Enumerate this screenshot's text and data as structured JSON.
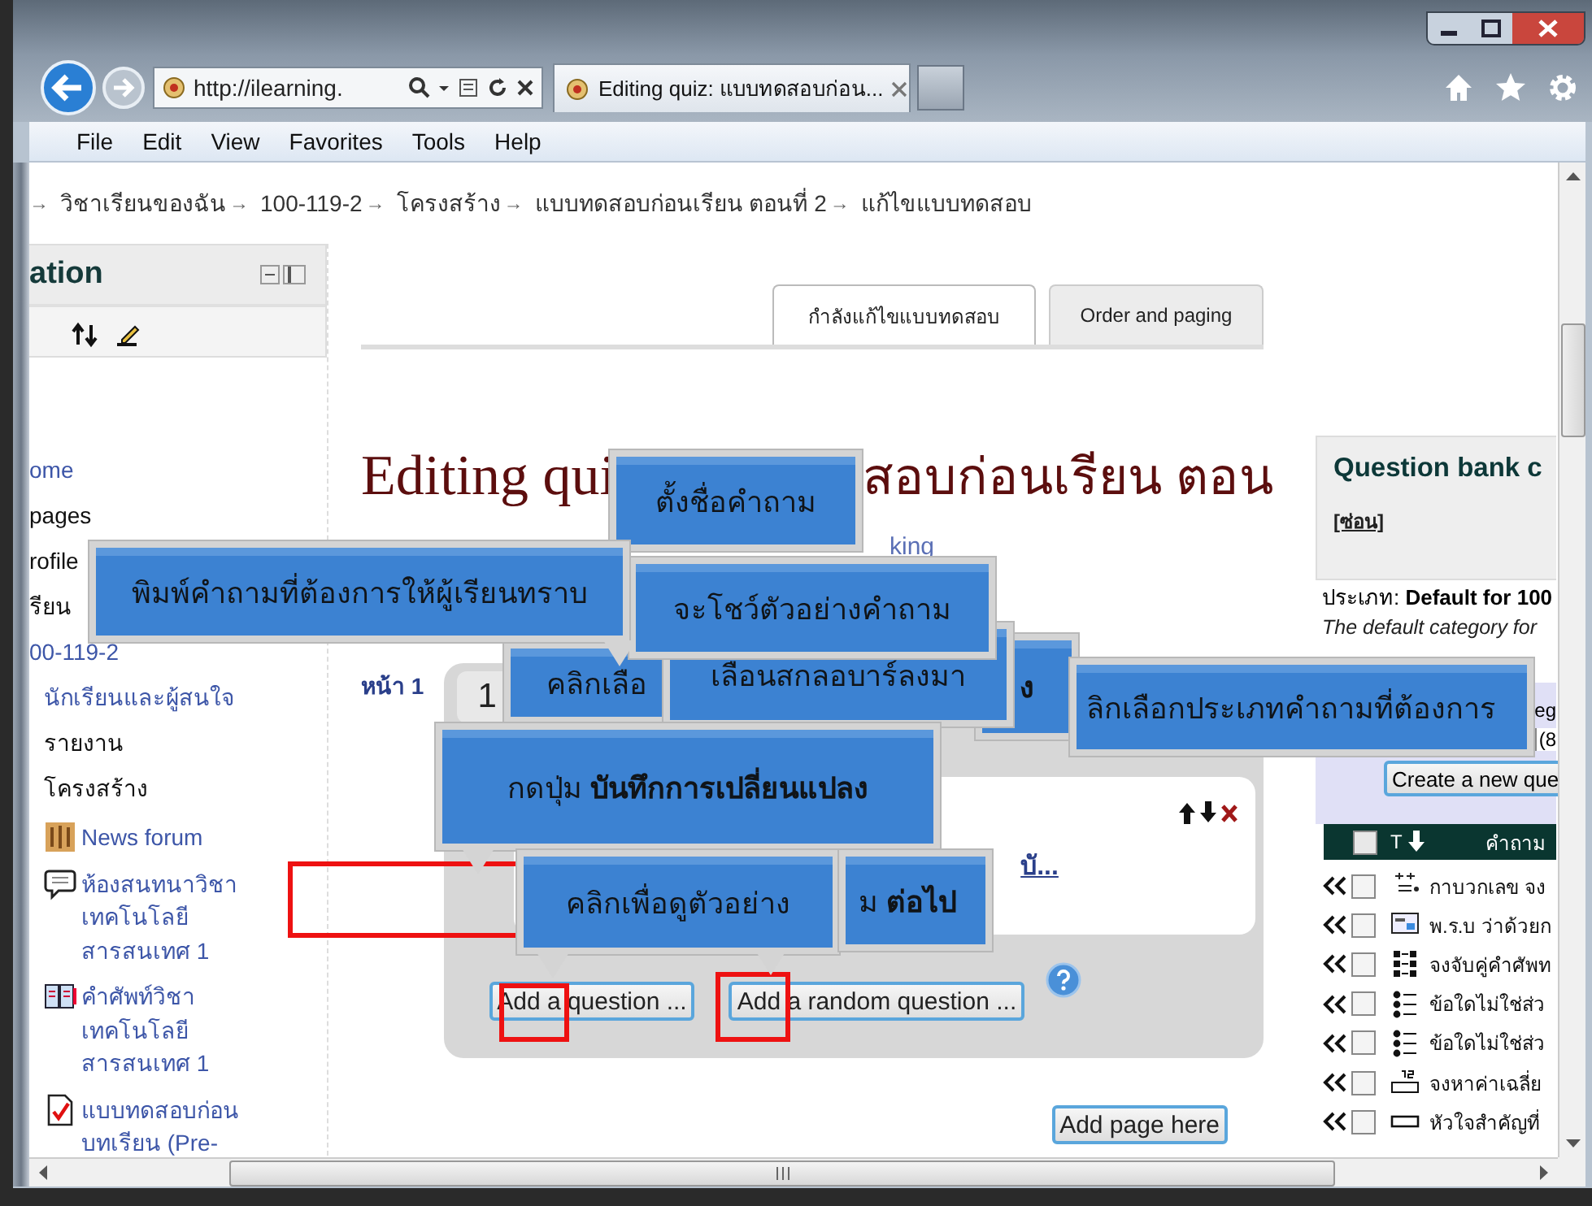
{
  "browser": {
    "address": "http://ilearning.",
    "tab_title": "Editing quiz: แบบทดสอบก่อน..."
  },
  "menu": [
    "File",
    "Edit",
    "View",
    "Favorites",
    "Tools",
    "Help"
  ],
  "breadcrumb": [
    {
      "arrow": "→",
      "label": "วิชาเรียนของฉัน"
    },
    {
      "arrow": "→",
      "label": "100-119-2"
    },
    {
      "arrow": "→",
      "label": "โครงสร้าง"
    },
    {
      "arrow": "→",
      "label": "แบบทดสอบก่อนเรียน ตอนที่ 2"
    },
    {
      "arrow": "→",
      "label": "แก้ไขแบบทดสอบ"
    }
  ],
  "navigation": {
    "title": "ation",
    "items": [
      {
        "label": "ome",
        "kind": "link"
      },
      {
        "label": "pages",
        "kind": "text"
      },
      {
        "label": "rofile",
        "kind": "text"
      },
      {
        "label": "รียน",
        "kind": "text"
      },
      {
        "label": "00-119-2",
        "kind": "link",
        "children": [
          {
            "label": "นักเรียนและผู้สนใจ",
            "kind": "link"
          },
          {
            "label": "รายงาน",
            "kind": "text"
          },
          {
            "label": "โครงสร้าง",
            "kind": "text"
          },
          {
            "label": "News forum",
            "kind": "forum"
          },
          {
            "label": "ห้องสนทนาวิชา เทคโนโลยี สารสนเทศ 1",
            "kind": "chat"
          },
          {
            "label": "คำศัพท์วิชา เทคโนโลยี สารสนเทศ 1",
            "kind": "glossary"
          },
          {
            "label": "แบบทดสอบก่อน บทเรียน (Pre-",
            "kind": "quiz"
          }
        ]
      }
    ]
  },
  "tabs": [
    {
      "label": "กำลังแก้ไขแบบทดสอบ",
      "selected": true
    },
    {
      "label": "Order and paging",
      "selected": false
    }
  ],
  "heading": {
    "part_1": "Editing qui",
    "part_2": "สอบก่อนเรียน ตอน"
  },
  "link_fragment": "king",
  "page_label": "หน้า 1",
  "quiz": {
    "slot_number": "1",
    "question_link": "บั...",
    "buttons": [
      "Add a question ...",
      "Add a random question ..."
    ]
  },
  "add_page_button": "Add page here",
  "question_bank": {
    "title": "Question bank c",
    "hide_link": "[ซ่อน]",
    "category_label": "ประเภท:",
    "category_name": "Default for 100",
    "category_info": "The default category for",
    "label_fragment": "eg",
    "select_fragment": "(8",
    "create_button": "Create a new que",
    "select_all_checked": false,
    "columns": [
      "T",
      "คำถาม"
    ],
    "rows": [
      {
        "kind": "calculated",
        "text": "กาบวกเลข จง",
        "checked": false
      },
      {
        "kind": "description",
        "text": "พ.ร.บ ว่าด้วยก",
        "checked": false
      },
      {
        "kind": "matching",
        "text": "จงจับคู่คำศัพท",
        "checked": false
      },
      {
        "kind": "multichoice",
        "text": "ข้อใดไม่ใช่ส่ว",
        "checked": false
      },
      {
        "kind": "multichoice",
        "text": "ข้อใดไม่ใช่ส่ว",
        "checked": false
      },
      {
        "kind": "numerical",
        "text": "จงหาค่าเฉลี่ย",
        "checked": false
      },
      {
        "kind": "shortanswer",
        "text": "หัวใจสำคัญที่",
        "checked": false
      }
    ]
  },
  "callouts": [
    {
      "text": "ตั้งชื่อคำถาม",
      "pointer": false
    },
    {
      "text": "พิมพ์คำถามที่ต้องการให้ผู้เรียนทราบ",
      "pointer": true
    },
    {
      "text": "จะโชว์ตัวอย่างคำถาม",
      "pointer": false
    },
    {
      "text": "คลิกเลือ",
      "pointer": false
    },
    {
      "text": "เลือนสกลอบาร์ลงมา",
      "pointer": false
    },
    {
      "text": "**ง**",
      "pointer": false
    },
    {
      "text": "ลิกเลือกประเภทคำถามที่ต้องการ",
      "pointer": false
    },
    {
      "text": "กดปุ่ม  **บันทึกการเปลี่ยนแปลง**",
      "pointer": true
    },
    {
      "text": "คลิกเพื่อดูตัวอย่าง",
      "pointer": true
    },
    {
      "text": "ม **ต่อไป**",
      "pointer": true
    }
  ]
}
